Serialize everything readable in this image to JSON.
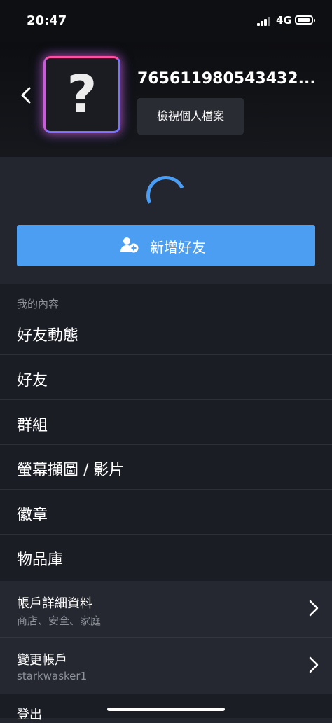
{
  "status_bar": {
    "time": "20:47",
    "network": "4G"
  },
  "profile": {
    "avatar_glyph": "?",
    "username": "765611980543432...",
    "view_profile_label": "檢視個人檔案"
  },
  "actions": {
    "add_friend_label": "新增好友"
  },
  "menu": {
    "section_title": "我的內容",
    "items": [
      {
        "label": "好友動態"
      },
      {
        "label": "好友"
      },
      {
        "label": "群組"
      },
      {
        "label": "螢幕擷圖 / 影片"
      },
      {
        "label": "徽章"
      },
      {
        "label": "物品庫"
      }
    ],
    "account_details": {
      "title": "帳戶詳細資料",
      "subtitle": "商店、安全、家庭"
    },
    "switch_account": {
      "title": "變更帳戶",
      "subtitle": "starkwasker1"
    },
    "logout_label": "登出"
  },
  "colors": {
    "accent": "#4b9ef1",
    "background": "#1b1d25",
    "header": "#0d0e11",
    "secondary_text": "#8e9299"
  }
}
